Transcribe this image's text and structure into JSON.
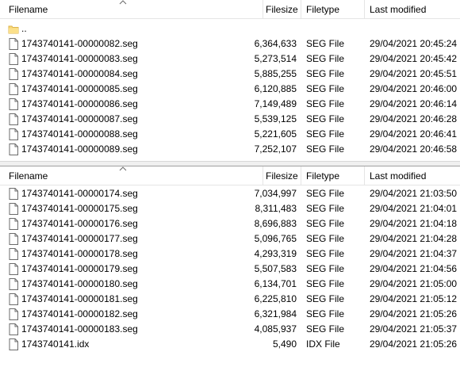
{
  "columns": {
    "filename": "Filename",
    "filesize": "Filesize",
    "filetype": "Filetype",
    "last_modified": "Last modified"
  },
  "top_pane": {
    "parent_row": {
      "name": "..",
      "icon": "folder-icon"
    },
    "rows": [
      {
        "name": "1743740141-00000082.seg",
        "size": "6,364,633",
        "type": "SEG File",
        "modified": "29/04/2021 20:45:24"
      },
      {
        "name": "1743740141-00000083.seg",
        "size": "5,273,514",
        "type": "SEG File",
        "modified": "29/04/2021 20:45:42"
      },
      {
        "name": "1743740141-00000084.seg",
        "size": "5,885,255",
        "type": "SEG File",
        "modified": "29/04/2021 20:45:51"
      },
      {
        "name": "1743740141-00000085.seg",
        "size": "6,120,885",
        "type": "SEG File",
        "modified": "29/04/2021 20:46:00"
      },
      {
        "name": "1743740141-00000086.seg",
        "size": "7,149,489",
        "type": "SEG File",
        "modified": "29/04/2021 20:46:14"
      },
      {
        "name": "1743740141-00000087.seg",
        "size": "5,539,125",
        "type": "SEG File",
        "modified": "29/04/2021 20:46:28"
      },
      {
        "name": "1743740141-00000088.seg",
        "size": "5,221,605",
        "type": "SEG File",
        "modified": "29/04/2021 20:46:41"
      },
      {
        "name": "1743740141-00000089.seg",
        "size": "7,252,107",
        "type": "SEG File",
        "modified": "29/04/2021 20:46:58"
      }
    ]
  },
  "bottom_pane": {
    "rows": [
      {
        "name": "1743740141-00000174.seg",
        "size": "7,034,997",
        "type": "SEG File",
        "modified": "29/04/2021 21:03:50"
      },
      {
        "name": "1743740141-00000175.seg",
        "size": "8,311,483",
        "type": "SEG File",
        "modified": "29/04/2021 21:04:01"
      },
      {
        "name": "1743740141-00000176.seg",
        "size": "8,696,883",
        "type": "SEG File",
        "modified": "29/04/2021 21:04:18"
      },
      {
        "name": "1743740141-00000177.seg",
        "size": "5,096,765",
        "type": "SEG File",
        "modified": "29/04/2021 21:04:28"
      },
      {
        "name": "1743740141-00000178.seg",
        "size": "4,293,319",
        "type": "SEG File",
        "modified": "29/04/2021 21:04:37"
      },
      {
        "name": "1743740141-00000179.seg",
        "size": "5,507,583",
        "type": "SEG File",
        "modified": "29/04/2021 21:04:56"
      },
      {
        "name": "1743740141-00000180.seg",
        "size": "6,134,701",
        "type": "SEG File",
        "modified": "29/04/2021 21:05:00"
      },
      {
        "name": "1743740141-00000181.seg",
        "size": "6,225,810",
        "type": "SEG File",
        "modified": "29/04/2021 21:05:12"
      },
      {
        "name": "1743740141-00000182.seg",
        "size": "6,321,984",
        "type": "SEG File",
        "modified": "29/04/2021 21:05:26"
      },
      {
        "name": "1743740141-00000183.seg",
        "size": "4,085,937",
        "type": "SEG File",
        "modified": "29/04/2021 21:05:37"
      },
      {
        "name": "1743740141.idx",
        "size": "5,490",
        "type": "IDX File",
        "modified": "29/04/2021 21:05:26"
      }
    ]
  },
  "colors": {
    "header_separator": "#e5e5e5",
    "folder_fill": "#f8d775",
    "folder_edge": "#dcb450",
    "file_edge": "#6b6b6b"
  }
}
